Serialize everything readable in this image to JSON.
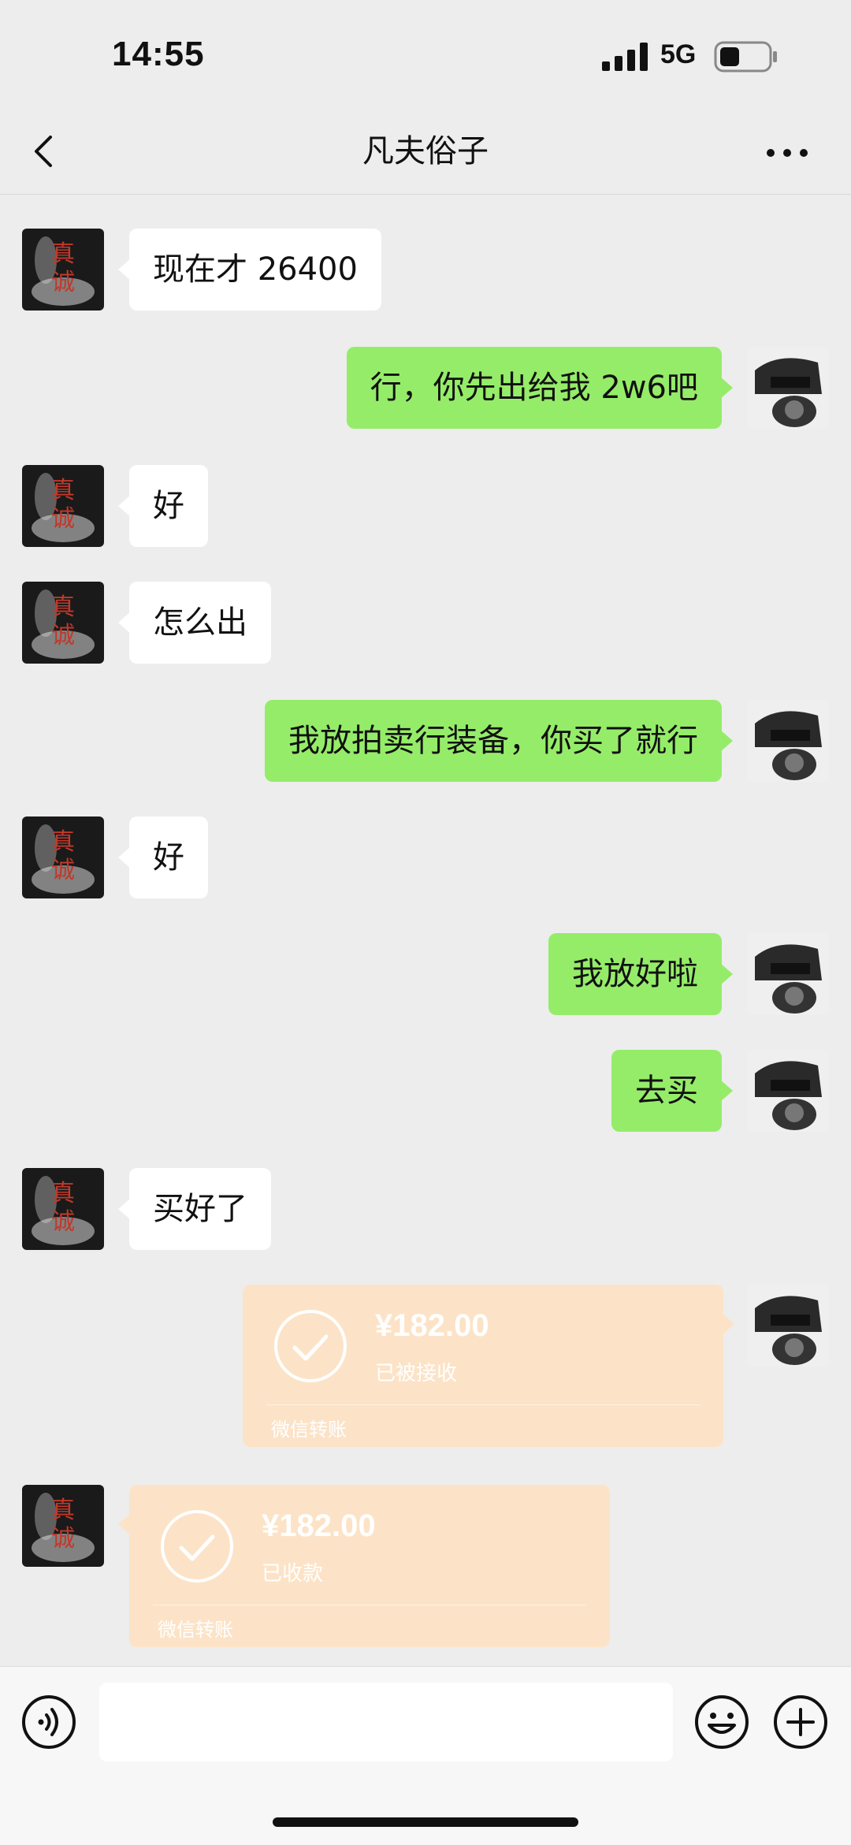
{
  "status_bar": {
    "time": "14:55",
    "network": "5G",
    "icons": [
      "signal-icon",
      "battery-icon"
    ]
  },
  "header": {
    "title": "凡夫俗子",
    "icons": [
      "back-chevron-icon",
      "more-dots-icon"
    ]
  },
  "messages": [
    {
      "side": "left",
      "text": "现在才 26400"
    },
    {
      "side": "right",
      "text": "行，你先出给我 2w6吧"
    },
    {
      "side": "left",
      "text": "好"
    },
    {
      "side": "left",
      "text": "怎么出"
    },
    {
      "side": "right",
      "text": "我放拍卖行装备，你买了就行"
    },
    {
      "side": "left",
      "text": "好"
    },
    {
      "side": "right",
      "text": "我放好啦"
    },
    {
      "side": "right",
      "text": "去买"
    },
    {
      "side": "left",
      "text": "买好了"
    }
  ],
  "transfers": [
    {
      "side": "right",
      "amount": "¥182.00",
      "status": "已被接收",
      "source": "微信转账"
    },
    {
      "side": "left",
      "amount": "¥182.00",
      "status": "已收款",
      "source": "微信转账"
    }
  ],
  "avatars": {
    "contact_glyphs": [
      "真",
      "诚"
    ]
  },
  "input_bar": {
    "value": "",
    "icons": [
      "voice-icon",
      "emoji-icon",
      "plus-icon"
    ]
  },
  "colors": {
    "background": "#ededed",
    "self_bubble": "#95ec69",
    "other_bubble": "#ffffff",
    "transfer_card": "#fce3c7"
  }
}
